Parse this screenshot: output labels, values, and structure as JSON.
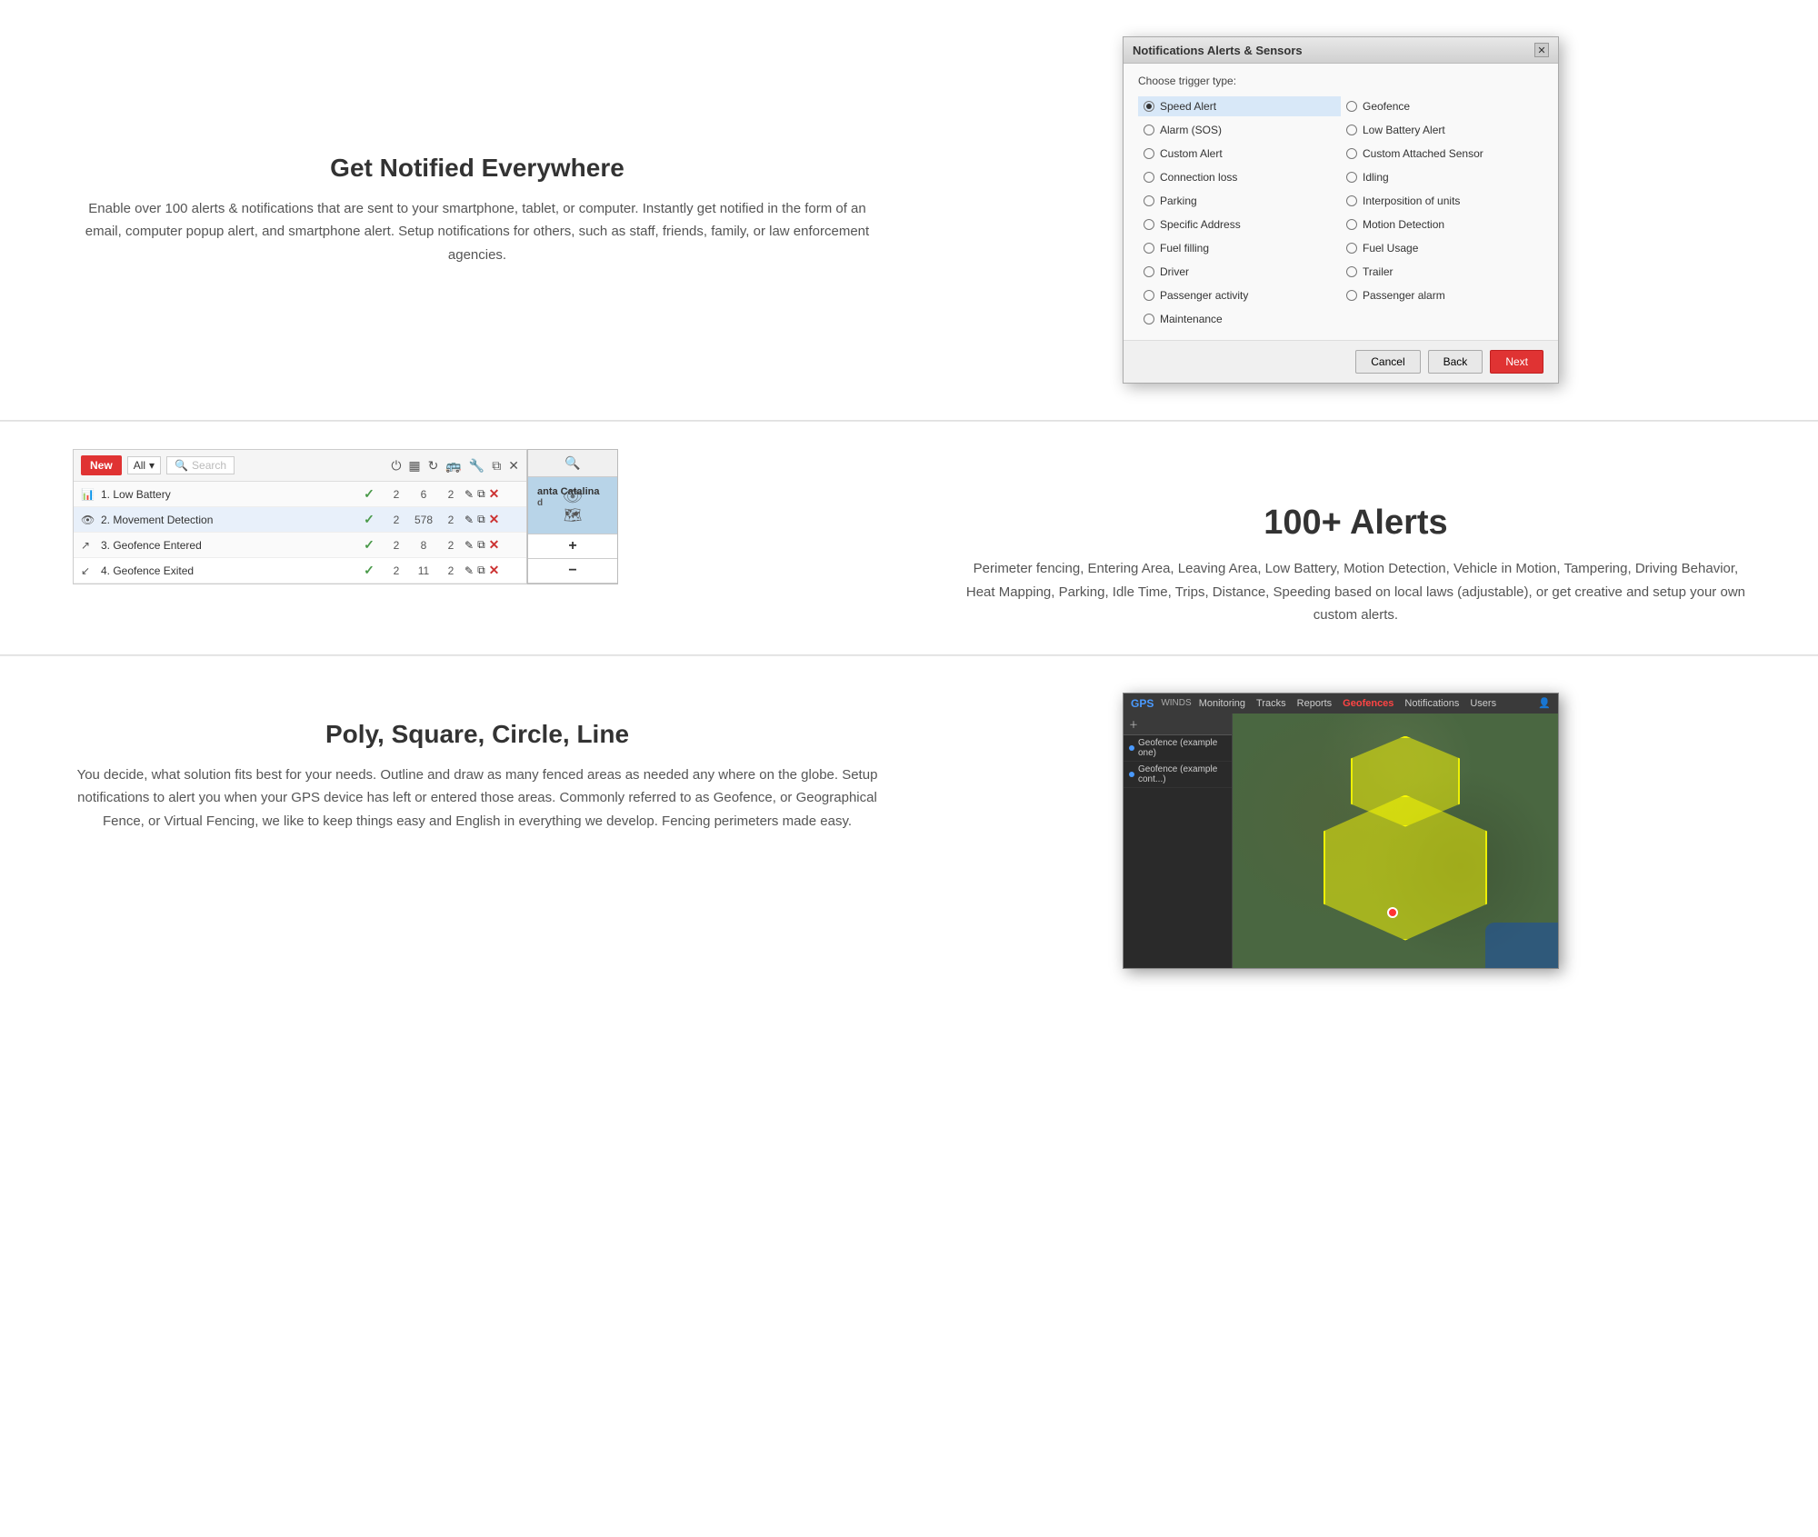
{
  "section1": {
    "heading": "Get Notified Everywhere",
    "body": "Enable over 100 alerts & notifications that are sent to your smartphone, tablet, or computer. Instantly get notified in the form of an email, computer popup alert, and smartphone alert. Setup notifications for others, such as staff, friends, family, or law enforcement agencies.",
    "dialog": {
      "title": "Notifications Alerts & Sensors",
      "trigger_label": "Choose trigger type:",
      "options_left": [
        {
          "label": "Speed Alert",
          "selected": true
        },
        {
          "label": "Alarm (SOS)",
          "selected": false
        },
        {
          "label": "Custom Alert",
          "selected": false
        },
        {
          "label": "Connection loss",
          "selected": false
        },
        {
          "label": "Parking",
          "selected": false
        },
        {
          "label": "Specific Address",
          "selected": false
        },
        {
          "label": "Fuel filling",
          "selected": false
        },
        {
          "label": "Driver",
          "selected": false
        },
        {
          "label": "Passenger activity",
          "selected": false
        },
        {
          "label": "Maintenance",
          "selected": false
        }
      ],
      "options_right": [
        {
          "label": "Geofence",
          "selected": false
        },
        {
          "label": "Low Battery Alert",
          "selected": false
        },
        {
          "label": "Custom Attached Sensor",
          "selected": false
        },
        {
          "label": "Idling",
          "selected": false
        },
        {
          "label": "Interposition of units",
          "selected": false
        },
        {
          "label": "Motion Detection",
          "selected": false
        },
        {
          "label": "Fuel Usage",
          "selected": false
        },
        {
          "label": "Trailer",
          "selected": false
        },
        {
          "label": "Passenger alarm",
          "selected": false
        }
      ],
      "btn_cancel": "Cancel",
      "btn_back": "Back",
      "btn_next": "Next"
    }
  },
  "section2": {
    "heading": "100+ Alerts",
    "body": "Perimeter fencing, Entering Area, Leaving Area, Low Battery, Motion Detection, Vehicle in Motion, Tampering, Driving Behavior, Heat Mapping, Parking, Idle Time, Trips, Distance, Speeding based on local laws (adjustable), or get creative and setup your own custom alerts.",
    "panel": {
      "new_btn": "New",
      "all_label": "All",
      "search_placeholder": "Search",
      "rows": [
        {
          "icon": "chart",
          "name": "1. Low Battery",
          "check": true,
          "n1": 2,
          "n2": 6,
          "n3": 2
        },
        {
          "icon": "eye",
          "name": "2. Movement Detection",
          "check": true,
          "n1": 2,
          "n2": 578,
          "n3": 2
        },
        {
          "icon": "geo",
          "name": "3. Geofence Entered",
          "check": true,
          "n1": 2,
          "n2": 8,
          "n3": 2
        },
        {
          "icon": "geo2",
          "name": "4. Geofence Exited",
          "check": true,
          "n1": 2,
          "n2": 11,
          "n3": 2
        }
      ]
    },
    "map": {
      "location": "anta Catalina",
      "zoom_in": "+",
      "zoom_out": "−"
    }
  },
  "section3": {
    "heading": "Poly, Square, Circle, Line",
    "body": "You decide, what solution fits best for your needs. Outline and draw as many fenced areas as needed any where on the globe. Setup notifications to alert you when your GPS device has left or entered those areas. Commonly referred to as Geofence, or Geographical Fence, or Virtual Fencing, we like to keep things easy and English in everything we develop. Fencing perimeters made easy.",
    "gps_brand": "GPS",
    "gps_nav_items": [
      "Monitoring",
      "Tracks",
      "Reports",
      "Geofences",
      "Notifications",
      "Users"
    ],
    "gps_nav_active": "Geofences",
    "sidebar_items": [
      "Geofence (example one)",
      "Geofence (example cont...)"
    ]
  }
}
